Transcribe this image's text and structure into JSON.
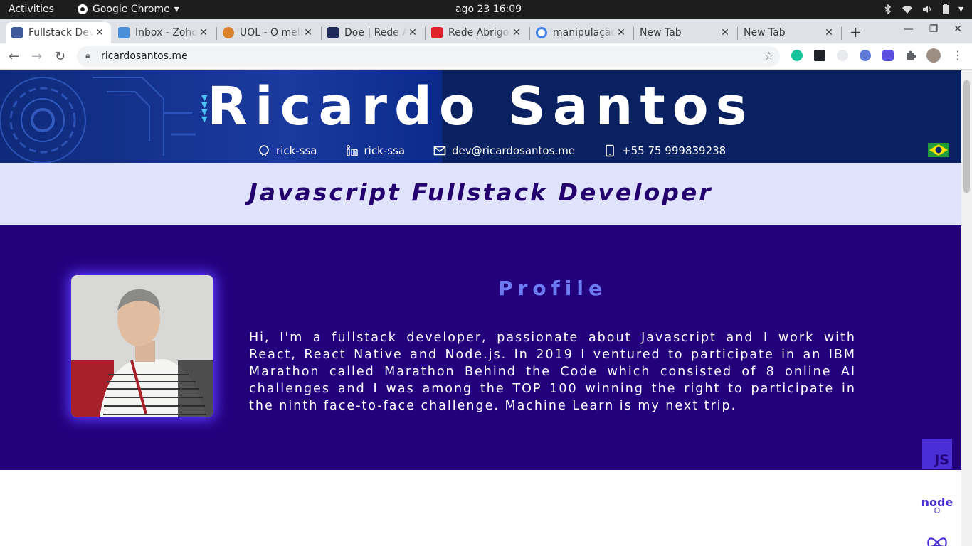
{
  "desktop": {
    "activities": "Activities",
    "app_name": "Google Chrome",
    "clock": "ago 23  16:09"
  },
  "browser": {
    "tabs": [
      {
        "title": "Fullstack Developer",
        "favicon_color": "#3f5a9a",
        "active": true
      },
      {
        "title": "Inbox - Zoho Mail",
        "favicon_color": "#4a90d9",
        "active": false
      },
      {
        "title": "UOL - O melhor conteúdo",
        "favicon_color": "#d9822b",
        "active": false
      },
      {
        "title": "Doe | Rede Abrigo",
        "favicon_color": "#1f2a5a",
        "active": false
      },
      {
        "title": "Rede Abrigo",
        "favicon_color": "#e0202a",
        "active": false
      },
      {
        "title": "manipulação",
        "favicon_color": "#4285f4",
        "active": false
      },
      {
        "title": "New Tab",
        "favicon_color": "",
        "active": false
      },
      {
        "title": "New Tab",
        "favicon_color": "",
        "active": false
      }
    ],
    "url": "ricardosantos.me"
  },
  "hero": {
    "name": "Ricardo Santos",
    "contacts": {
      "github": "rick-ssa",
      "linkedin": "rick-ssa",
      "email": "dev@ricardosantos.me",
      "phone": "+55 75 999839238"
    }
  },
  "subtitle": "Javascript Fullstack Developer",
  "profile": {
    "title": "Profile",
    "bio": "Hi, I'm a fullstack developer, passionate about Javascript and I work with React, React Native and Node.js. In 2019 I ventured to participate in an IBM Marathon called Marathon Behind the Code which consisted of 8 online AI challenges and I was among the TOP 100 winning the right to participate in the ninth face-to-face challenge. Machine Learn is my next trip."
  },
  "tech_icons": {
    "js_label": "JS",
    "node_label": "node"
  },
  "colors": {
    "hero_bg": "#092160",
    "subtitle_bg": "#dfe3fb",
    "subtitle_text": "#24006e",
    "profile_bg": "#23007c",
    "profile_title": "#6d7cf2",
    "icon_color": "#4b2fd6"
  }
}
